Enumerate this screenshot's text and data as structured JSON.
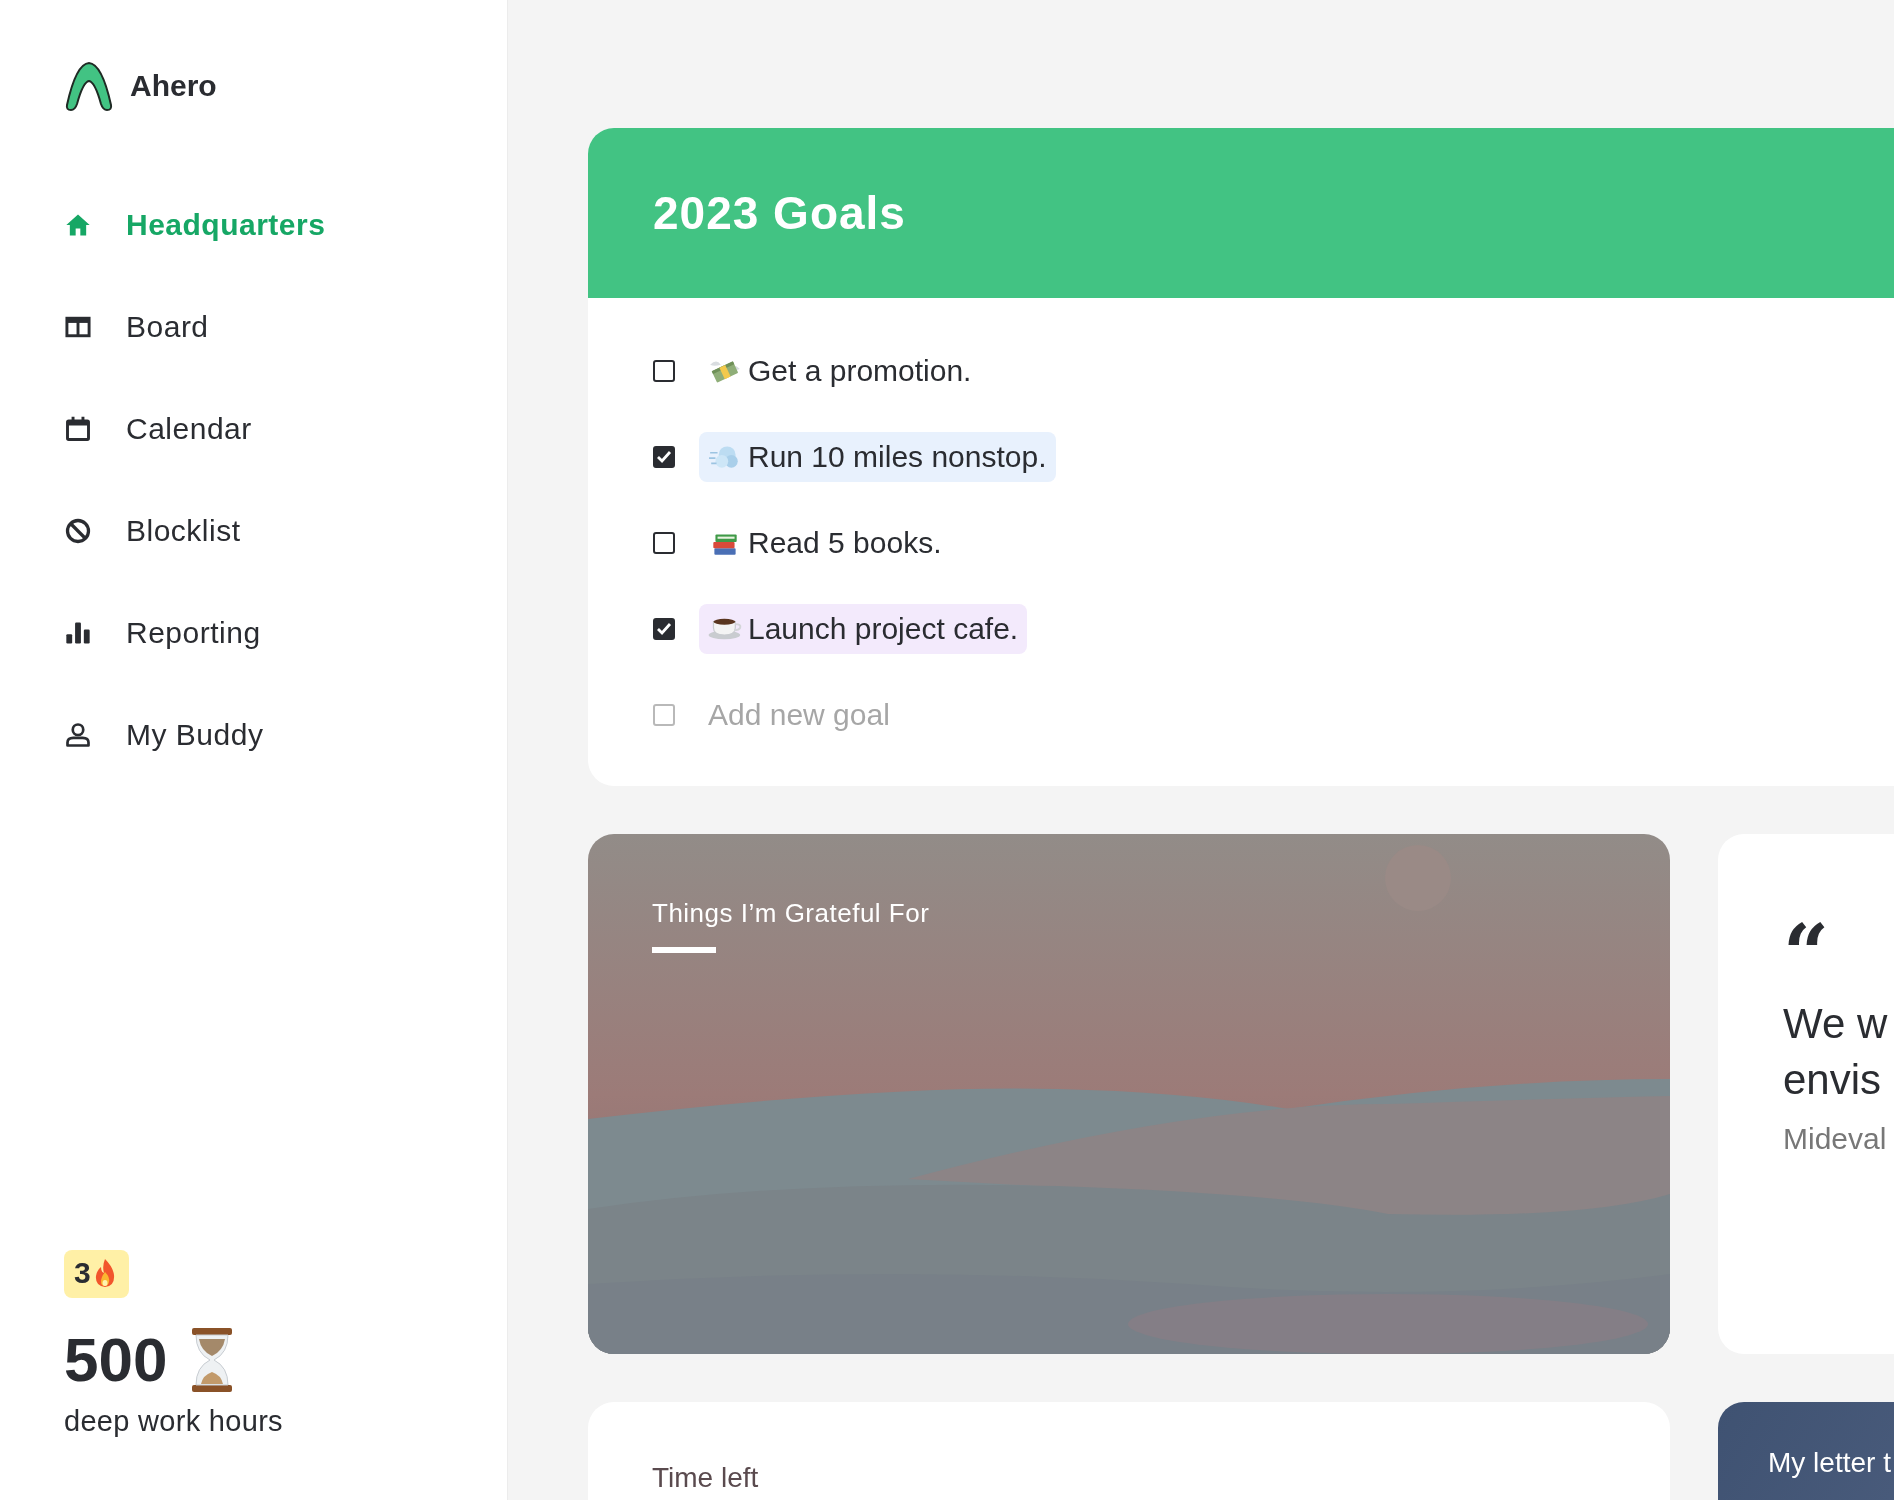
{
  "brand": {
    "name": "Ahero"
  },
  "nav": [
    {
      "label": "Headquarters",
      "selected": true
    },
    {
      "label": "Board",
      "selected": false
    },
    {
      "label": "Calendar",
      "selected": false
    },
    {
      "label": "Blocklist",
      "selected": false
    },
    {
      "label": "Reporting",
      "selected": false
    },
    {
      "label": "My Buddy",
      "selected": false
    }
  ],
  "streak": {
    "count": "3"
  },
  "deep_work": {
    "value": "500",
    "label": "deep work hours"
  },
  "goals": {
    "title": "2023 Goals",
    "items": [
      {
        "text": "Get a promotion.",
        "checked": false
      },
      {
        "text": "Run 10 miles nonstop.",
        "checked": true,
        "color": "#e8f1fd"
      },
      {
        "text": "Read 5 books.",
        "checked": false
      },
      {
        "text": "Launch project cafe.",
        "checked": true,
        "color": "#f3eafc"
      }
    ],
    "new_goal": {
      "placeholder": "Add new goal",
      "checked": false
    }
  },
  "grateful": {
    "title": "Things I’m Grateful For"
  },
  "quote": {
    "mark": "“",
    "lines": [
      "We w",
      "envis"
    ],
    "author": "Mideval"
  },
  "time_left": {
    "title": "Time left"
  },
  "letter": {
    "title": "My letter t"
  }
}
